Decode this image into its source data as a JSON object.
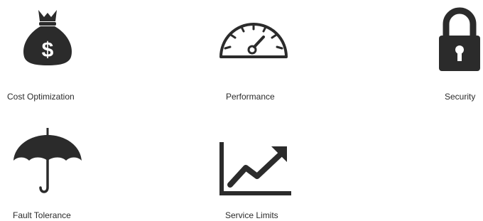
{
  "categories": [
    {
      "id": "cost-optimization",
      "label": "Cost Optimization",
      "icon": "money-bag-icon",
      "symbol": "$"
    },
    {
      "id": "performance",
      "label": "Performance",
      "icon": "speedometer-icon"
    },
    {
      "id": "security",
      "label": "Security",
      "icon": "padlock-icon"
    },
    {
      "id": "fault-tolerance",
      "label": "Fault Tolerance",
      "icon": "umbrella-icon"
    },
    {
      "id": "service-limits",
      "label": "Service Limits",
      "icon": "trend-chart-icon"
    }
  ],
  "colors": {
    "icon": "#2b2b2b",
    "text": "#2b2b2b",
    "background": "#ffffff"
  }
}
